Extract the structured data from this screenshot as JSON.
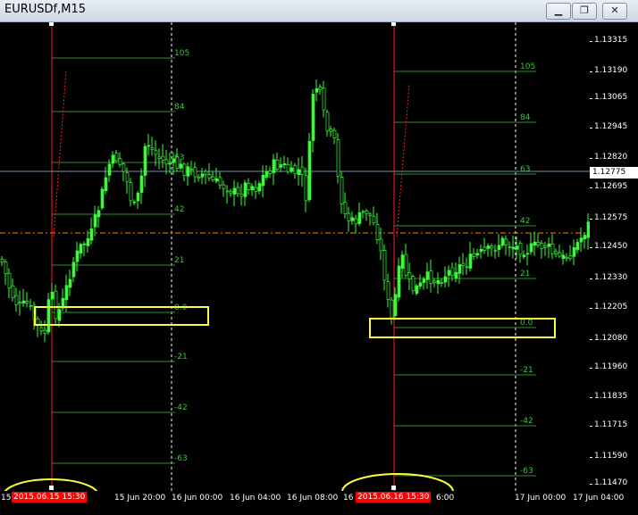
{
  "window": {
    "title": "EURUSDf,M15",
    "buttons": {
      "minimize": "▁",
      "restore": "❐",
      "close": "✕"
    }
  },
  "y_axis": {
    "ticks": [
      "1.13315",
      "1.13190",
      "1.13065",
      "1.12945",
      "1.12820",
      "1.12695",
      "1.12575",
      "1.12450",
      "1.12330",
      "1.12205",
      "1.12080",
      "1.11960",
      "1.11835",
      "1.11715",
      "1.11590",
      "1.11470"
    ],
    "current_price": "1.12775"
  },
  "x_axis": {
    "ticks": [
      "15",
      "15 Jun 20:00",
      "16 Jun 00:00",
      "16 Jun 04:00",
      "16 Jun 08:00",
      "16",
      "6:00",
      "17 Jun 00:00",
      "17 Jun 04:00"
    ],
    "highlight_1": "2015.06.15 15:30",
    "highlight_2": "2015.06.16 15:30"
  },
  "fib_levels": {
    "left": [
      "105",
      "84",
      "63",
      "42",
      "21",
      "0.0",
      "-21",
      "-42",
      "-63"
    ],
    "right": [
      "105",
      "84",
      "63",
      "42",
      "21",
      "0.0",
      "-21",
      "-42",
      "-63"
    ]
  },
  "colors": {
    "background": "#000000",
    "candles": "#33ff33",
    "fib_lines": "#2e8b2e",
    "event_line": "#ff2020",
    "highlight_box": "#ffff33",
    "current_price_line": "#6b8fa8",
    "dashed_level": "#ff8800"
  }
}
